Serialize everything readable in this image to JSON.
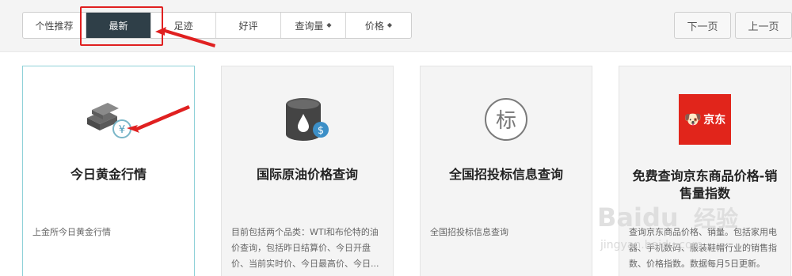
{
  "tabs": [
    {
      "label": "个性推荐"
    },
    {
      "label": "最新"
    },
    {
      "label": "足迹"
    },
    {
      "label": "好评"
    },
    {
      "label": "查询量",
      "sort_icon": "sort-icon"
    },
    {
      "label": "价格",
      "sort_icon": "sort-icon"
    }
  ],
  "active_tab": "最新",
  "pager": {
    "next_label": "下一页",
    "prev_label": "上一页"
  },
  "sort_glyph": "◆",
  "cards": [
    {
      "title": "今日黄金行情",
      "desc": "上金所今日黄金行情",
      "icon": "gold-bars-icon",
      "yen": "¥"
    },
    {
      "title": "国际原油价格查询",
      "desc": "目前包括两个品类：WTI和布伦特的油价查询，包括昨日结算价、今日开盘价、当前实时价、今日最高价、今日...",
      "icon": "oil-barrel-icon",
      "dollar": "$"
    },
    {
      "title": "全国招投标信息查询",
      "desc": "全国招投标信息查询",
      "icon": "bid-icon",
      "icon_text": "标"
    },
    {
      "title": "免费查询京东商品价格-销售量指数",
      "desc": "查询京东商品价格、销量。包括家用电器、手机数码、服装鞋帽行业的销售指数、价格指数。数据每月5日更新。",
      "icon": "jd-logo-icon",
      "icon_text": "京东"
    }
  ],
  "colors": {
    "annotation": "#e02020",
    "active_tab": "#2f3f48",
    "selected_border": "#8fd1d8",
    "jd_red": "#e1251b"
  },
  "watermark": {
    "brand": "Baidu",
    "cn": "经验",
    "url": "jingyan.baidu.com"
  }
}
